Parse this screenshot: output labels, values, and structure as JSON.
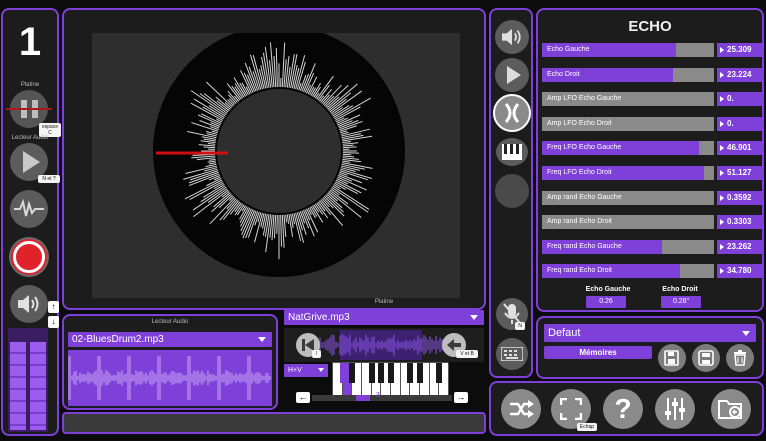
{
  "left": {
    "counter": "1",
    "platine_label": "Platine",
    "lecteur_label": "Lecteur Audio",
    "tip_pause": "espace C",
    "tip_play": "N et ?",
    "tip_up": "↑",
    "tip_down": "↓"
  },
  "lecteur": {
    "title": "Lecteur Audio",
    "file": "02-BluesDrum2.mp3"
  },
  "platine": {
    "title": "Platine",
    "file": "NatGrive.mp3",
    "tip_left": "/",
    "tip_right": "V et B",
    "mode": "H+V",
    "key_value": "3",
    "arrow_left": "←",
    "arrow_right": "→"
  },
  "icons": {
    "tip_mic": "N"
  },
  "echo": {
    "title": "ECHO",
    "sliders": [
      {
        "label": "Echo Gauche",
        "value": "25.309",
        "fraction": 0.78
      },
      {
        "label": "Echo Droit",
        "value": "23.224",
        "fraction": 0.76
      },
      {
        "label": "Amp LFO Echo Gauche",
        "value": "0.",
        "fraction": 0.0
      },
      {
        "label": "Amp LFO Echo Droit",
        "value": "0.",
        "fraction": 0.0
      },
      {
        "label": "Freq LFO Echo Gauche",
        "value": "46.901",
        "fraction": 0.91
      },
      {
        "label": "Freq LFO Echo Droit",
        "value": "51.127",
        "fraction": 0.94
      },
      {
        "label": "Amp rand Echo Gauche",
        "value": "0.3592",
        "fraction": 0.0
      },
      {
        "label": "Amp rand Echo Droit",
        "value": "0.3303",
        "fraction": 0.0
      },
      {
        "label": "Freq rand Echo Gauche",
        "value": "23.262",
        "fraction": 0.7
      },
      {
        "label": "Freq rand Echo Droit",
        "value": "34.780",
        "fraction": 0.8
      }
    ],
    "gauche_label": "Echo Gauche",
    "gauche_value": "0.26",
    "droit_label": "Echo Droit",
    "droit_value": "0.26\""
  },
  "memoires": {
    "preset": "Defaut",
    "button": "Mémoires"
  },
  "bottom": {
    "tip_fullscreen": "Echap"
  },
  "colors": {
    "accent": "#7f3fd9",
    "record": "#e0232b",
    "playhead": "#d01010"
  }
}
